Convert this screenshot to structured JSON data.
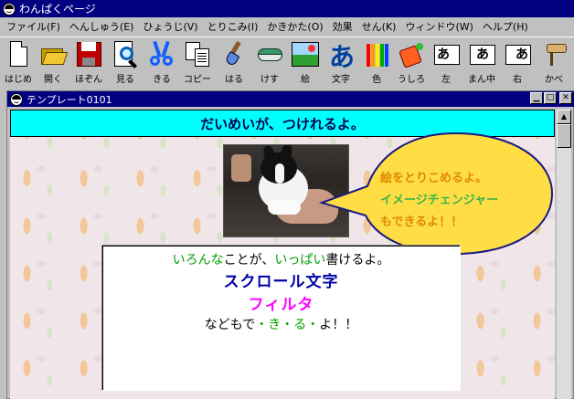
{
  "app": {
    "title": "わんぱくページ"
  },
  "menu": [
    "ファイル(F)",
    "へんしゅう(E)",
    "ひょうじ(V)",
    "とりこみ(I)",
    "かきかた(O)",
    "効果",
    "せん(K)",
    "ウィンドウ(W)",
    "ヘルプ(H)"
  ],
  "toolbar": {
    "items": [
      {
        "label": "はじめ",
        "icon": "new-page-icon"
      },
      {
        "label": "開く",
        "icon": "open-folder-icon"
      },
      {
        "label": "ほぞん",
        "icon": "save-disk-icon"
      },
      {
        "label": "見る",
        "icon": "magnifier-icon"
      },
      {
        "label": "きる",
        "icon": "scissors-icon"
      },
      {
        "label": "コピー",
        "icon": "copy-icon"
      },
      {
        "label": "はる",
        "icon": "paste-brush-icon"
      },
      {
        "label": "けす",
        "icon": "eraser-icon"
      },
      {
        "label": "絵",
        "icon": "picture-icon"
      },
      {
        "label": "文字",
        "icon": "text-a-icon"
      },
      {
        "label": "色",
        "icon": "crayons-icon"
      },
      {
        "label": "うしろ",
        "icon": "paint-bucket-icon"
      },
      {
        "label": "左",
        "icon": "align-left-icon"
      },
      {
        "label": "まん中",
        "icon": "align-center-icon"
      },
      {
        "label": "右",
        "icon": "align-right-icon"
      },
      {
        "label": "かべ",
        "icon": "wall-roller-icon"
      }
    ],
    "align_glyph": "あ",
    "text_glyph": "あ"
  },
  "document": {
    "title": "テンプレート0101",
    "banner": "だいめいが、つけれるよ。",
    "bubble": {
      "line1": "絵をとりこめるよ。",
      "line2": "イメージチェンジャー",
      "line3": "もできるよ！！"
    },
    "textbox": {
      "l1_a": "いろんな",
      "l1_b": "ことが、",
      "l1_c": "いっぱい",
      "l1_d": "書けるよ。",
      "l2": "スクロール文字",
      "l3": "フィルタ",
      "l4_a": "などもで",
      "l4_b": "・き・る・",
      "l4_c": "よ！！"
    }
  },
  "colors": {
    "banner_bg": "#00ffff",
    "bubble_fill": "#ffdd44",
    "bubble_text_orange": "#e08a00",
    "bubble_text_green": "#3ab54a",
    "scroll_text": "#0000a8",
    "filter_text": "#ff00ff",
    "green_text": "#00a000"
  }
}
